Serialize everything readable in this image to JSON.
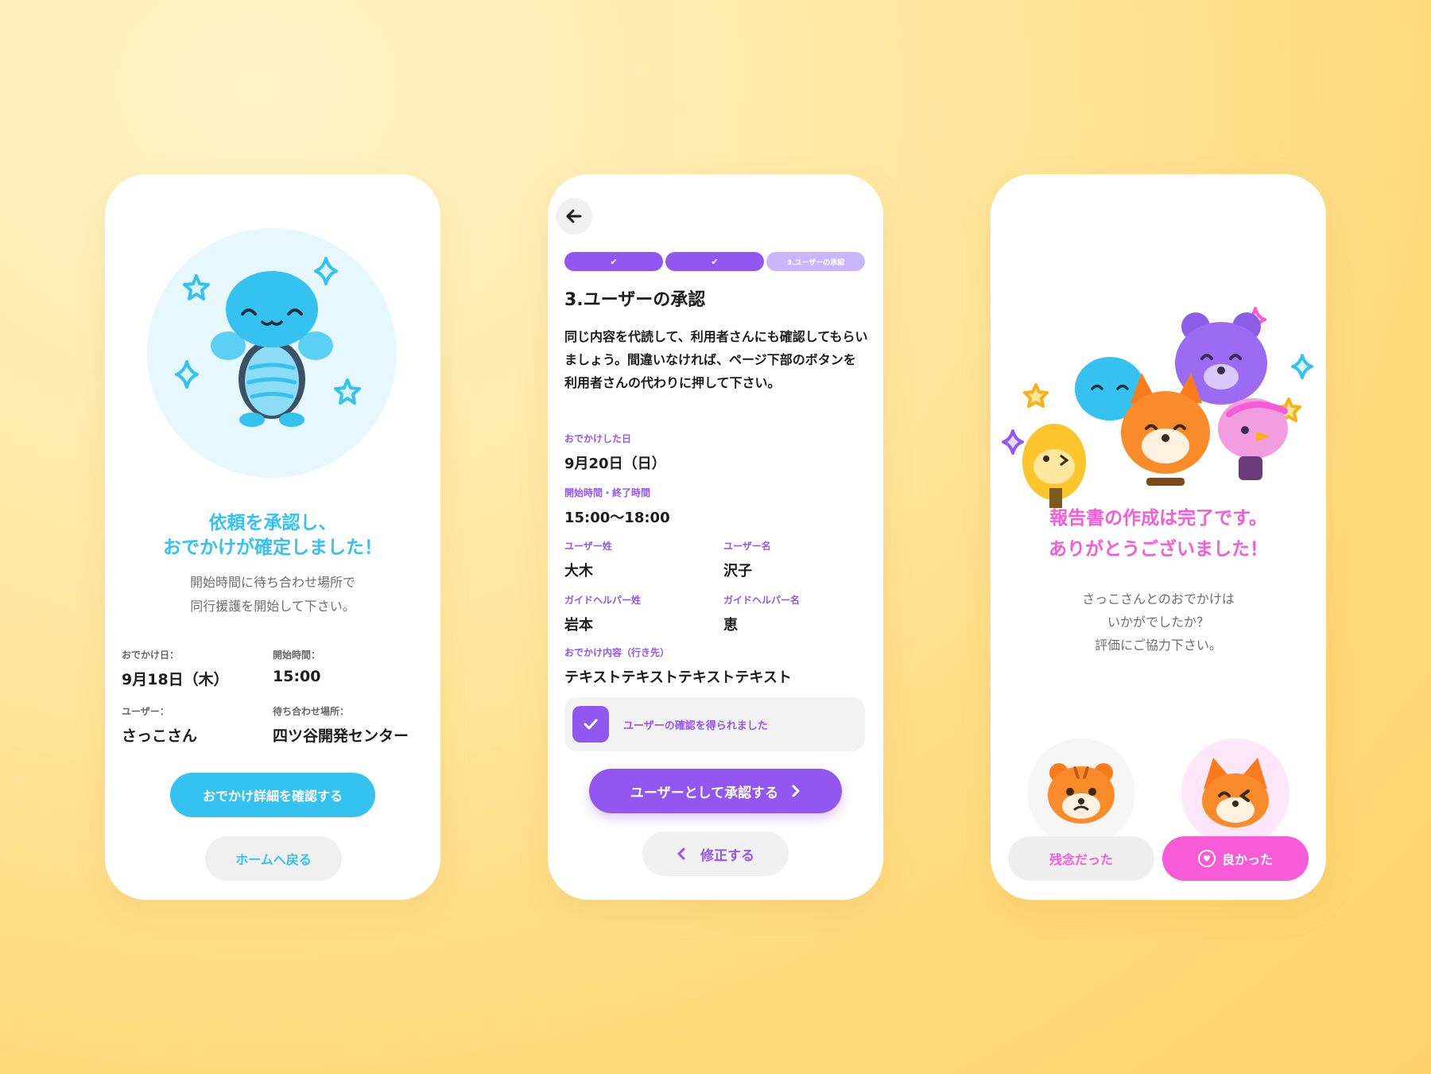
{
  "screen1": {
    "title_line1": "依頼を承認し、",
    "title_line2": "おでかけが確定しました！",
    "subtitle_line1": "開始時間に待ち合わせ場所で",
    "subtitle_line2": "同行援護を開始して下さい。",
    "details": [
      {
        "label": "おでかけ日：",
        "value": "9月18日（木）"
      },
      {
        "label": "開始時間：",
        "value": "15:00"
      },
      {
        "label": "ユーザー：",
        "value": "さっこさん"
      },
      {
        "label": "待ち合わせ場所：",
        "value": "四ツ谷開発センター"
      }
    ],
    "primary_button": "おでかけ詳細を確認する",
    "secondary_button": "ホームへ戻る",
    "accent_color": "#35c2f1"
  },
  "screen2": {
    "steps": [
      {
        "label": "✔"
      },
      {
        "label": "✔"
      },
      {
        "label": "3.ユーザーの承認"
      }
    ],
    "section_title": "3.ユーザーの承認",
    "description": "同じ内容を代読して、利用者さんにも確認してもらいましょう。間違いなければ、ページ下部のボタンを利用者さんの代わりに押して下さい。",
    "fields": {
      "date": {
        "label": "おでかけした日",
        "value": "9月20日（日）"
      },
      "time": {
        "label": "開始時間・終了時間",
        "value": "15:00〜18:00"
      },
      "user_last": {
        "label": "ユーザー姓",
        "value": "大木"
      },
      "user_first": {
        "label": "ユーザー名",
        "value": "沢子"
      },
      "helper_last": {
        "label": "ガイドヘルパー姓",
        "value": "岩本"
      },
      "helper_first": {
        "label": "ガイドヘルパー名",
        "value": "恵"
      },
      "content": {
        "label": "おでかけ内容（行き先）",
        "value": "テキストテキストテキストテキスト"
      }
    },
    "confirm_checkbox": {
      "label": "ユーザーの確認を得られました",
      "checked": true
    },
    "approve_button": "ユーザーとして承認する",
    "edit_button": "修正する",
    "accent_color": "#9157f0"
  },
  "screen3": {
    "title_line1": "報告書の作成は完了です。",
    "title_line2": "ありがとうございました！",
    "message_line1": "さっこさんとのおでかけは",
    "message_line2": "いかがでしたか？",
    "message_line3": "評価にご協力下さい。",
    "bad_button": "残念だった",
    "good_button": "良かった",
    "accent_color": "#f75bd8"
  }
}
